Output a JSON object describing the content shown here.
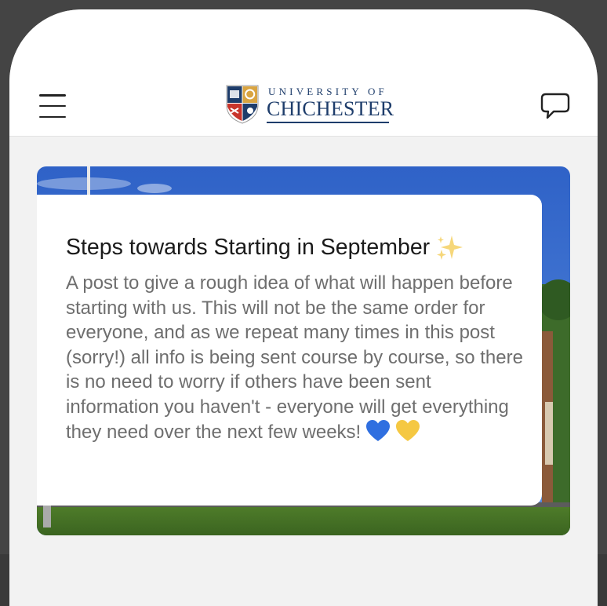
{
  "header": {
    "logo": {
      "line1": "UNIVERSITY OF",
      "line2": "CHICHESTER"
    },
    "menu_icon": "hamburger-icon",
    "chat_icon": "speech-bubble-icon"
  },
  "post": {
    "title": "Steps towards Starting in September",
    "title_emoji": "sparkles-icon",
    "body": "A post to give a rough idea of what will happen before starting with us. This will not be the same order for everyone, and as we repeat many times in this post (sorry!) all info is being sent course by course, so there is no need to worry if others have been sent information you haven't - everyone will get everything they need over the next few weeks!",
    "body_emojis": [
      "blue-heart-icon",
      "yellow-heart-icon"
    ]
  },
  "colors": {
    "brand_navy": "#1e3d6b",
    "title_text": "#1a1a1a",
    "body_text": "#6e6e6e",
    "blue_heart": "#2f6fe0",
    "yellow_heart": "#f5c842"
  }
}
